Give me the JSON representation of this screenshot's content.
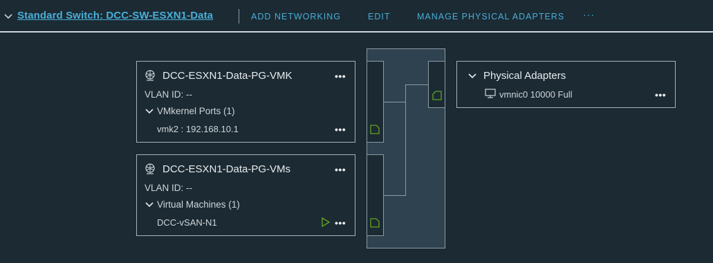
{
  "header": {
    "switch_title": "Standard Switch: DCC-SW-ESXN1-Data",
    "actions": [
      "ADD NETWORKING",
      "EDIT",
      "MANAGE PHYSICAL ADAPTERS"
    ],
    "more_label": "···"
  },
  "portgroups": [
    {
      "name": "DCC-ESXN1-Data-PG-VMK",
      "vlan": "VLAN ID: --",
      "section_label": "VMkernel Ports (1)",
      "items": [
        "vmk2 : 192.168.10.1"
      ]
    },
    {
      "name": "DCC-ESXN1-Data-PG-VMs",
      "vlan": "VLAN ID: --",
      "section_label": "Virtual Machines (1)",
      "items": [
        "DCC-vSAN-N1"
      ]
    }
  ],
  "physical_adapters": {
    "title": "Physical Adapters",
    "items": [
      "vmnic0 10000 Full"
    ]
  },
  "colors": {
    "background": "#1b2a33",
    "link": "#49afd9",
    "port_icon": "#62a420",
    "switch_fill": "#2e4250"
  },
  "icons": {
    "header_expand": "chevron-down-icon",
    "portgroup": "network-globe-icon",
    "section_expand": "chevron-down-icon",
    "port": "port-icon",
    "vm_power": "play-icon",
    "nic": "nic-monitor-icon"
  }
}
